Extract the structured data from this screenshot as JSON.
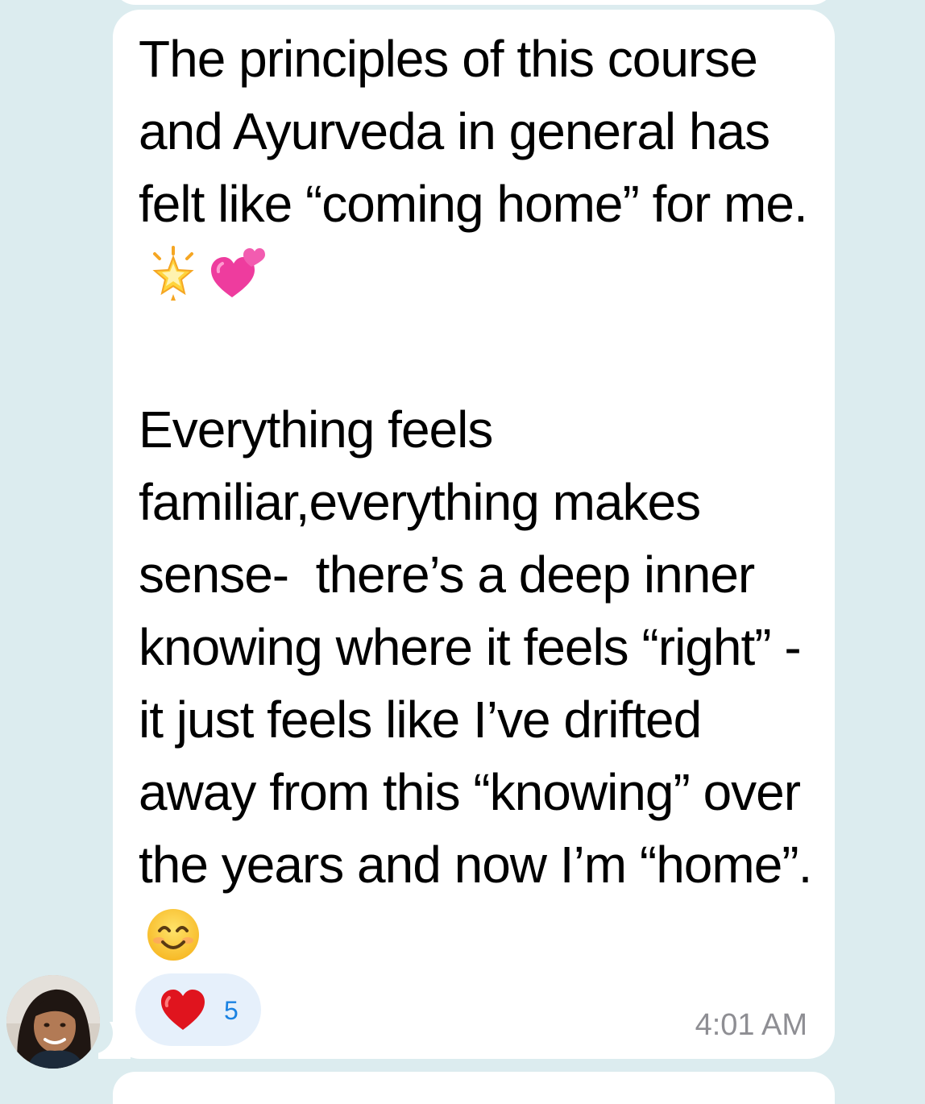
{
  "message": {
    "paragraph_1": "The principles of this course and Ayurveda in general has felt like “coming home” for me.",
    "paragraph_2": "Everything feels familiar,everything makes sense-  there’s a deep inner knowing where it feels “right” - it just feels like I’ve drifted away from this “knowing” over the years and now I’m “home”.",
    "paragraph_1_emojis": [
      "glowing-star-icon",
      "two-hearts-icon"
    ],
    "paragraph_2_emojis": [
      "smiling-face-icon"
    ]
  },
  "reaction": {
    "emoji": "red-heart-icon",
    "count": "5"
  },
  "timestamp": "4:01 AM",
  "sender": {
    "avatar_icon": "sender-avatar-photo"
  },
  "colors": {
    "background": "#dcecef",
    "bubble": "#ffffff",
    "reaction_pill": "#e6f0fb",
    "reaction_count": "#1a82e2",
    "timestamp": "#8e8e93"
  }
}
